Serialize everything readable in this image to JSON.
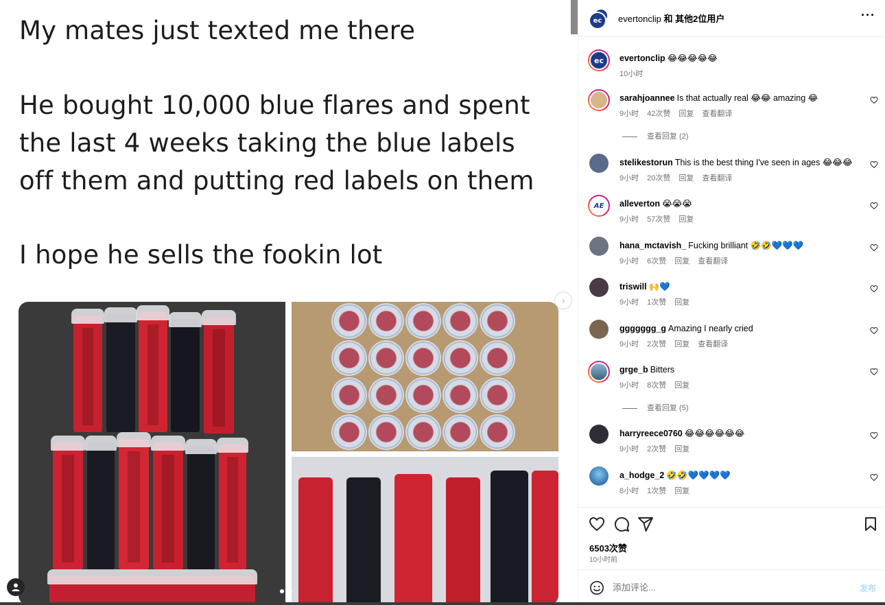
{
  "post": {
    "text_line1": "My mates just texted me there",
    "text_line2": "He bought 10,000 blue flares and spent",
    "text_line3": "the last 4 weeks taking the blue labels",
    "text_line4": "off them and putting red labels on them",
    "text_line5": "I hope he sells the fookin lot",
    "next_glyph": "›"
  },
  "header": {
    "owner": "evertonclip",
    "and_others": " 和 其他2位用户",
    "more_glyph": "···",
    "avatar_text": "ec"
  },
  "caption": {
    "username": "evertonclip",
    "text": "😂😂😂😂😂",
    "time": "10小时"
  },
  "comments": [
    {
      "username": "sarahjoannee",
      "text": "Is that actually real 😂😂 amazing 😂",
      "time": "9小时",
      "likes": "42次赞",
      "reply": "回复",
      "translate": "查看翻译",
      "view_replies": "查看回复 (2)"
    },
    {
      "username": "stelikestorun",
      "text": "This is the best thing I've seen in ages 😂😂😂",
      "time": "9小时",
      "likes": "20次赞",
      "reply": "回复",
      "translate": "查看翻译"
    },
    {
      "username": "alleverton",
      "text": "😭😭😭",
      "time": "9小时",
      "likes": "57次赞",
      "reply": "回复"
    },
    {
      "username": "hana_mctavish_",
      "text": "Fucking brilliant 🤣🤣💙💙💙",
      "time": "9小时",
      "likes": "6次赞",
      "reply": "回复",
      "translate": "查看翻译"
    },
    {
      "username": "triswill",
      "text": "🙌💙",
      "time": "9小时",
      "likes": "1次赞",
      "reply": "回复"
    },
    {
      "username": "ggggggg_g",
      "text": "Amazing I nearly cried",
      "time": "9小时",
      "likes": "2次赞",
      "reply": "回复",
      "translate": "查看翻译"
    },
    {
      "username": "grge_b",
      "text": "Bitters",
      "time": "9小时",
      "likes": "8次赞",
      "reply": "回复",
      "view_replies": "查看回复 (5)"
    },
    {
      "username": "harryreece0760",
      "text": "😂😂😂😂😂😂",
      "time": "9小时",
      "likes": "2次赞",
      "reply": "回复"
    },
    {
      "username": "a_hodge_2",
      "text": "🤣🤣💙💙💙💙",
      "time": "8小时",
      "likes": "1次赞",
      "reply": "回复"
    }
  ],
  "actions": {
    "likes_count": "6503次赞",
    "time_ago": "10小时前"
  },
  "comment_bar": {
    "placeholder": "添加评论...",
    "post_label": "发布"
  },
  "colors": {
    "everton_blue": "#1d3b8a",
    "muted_text": "#737373",
    "post_button": "#b2dffc"
  }
}
